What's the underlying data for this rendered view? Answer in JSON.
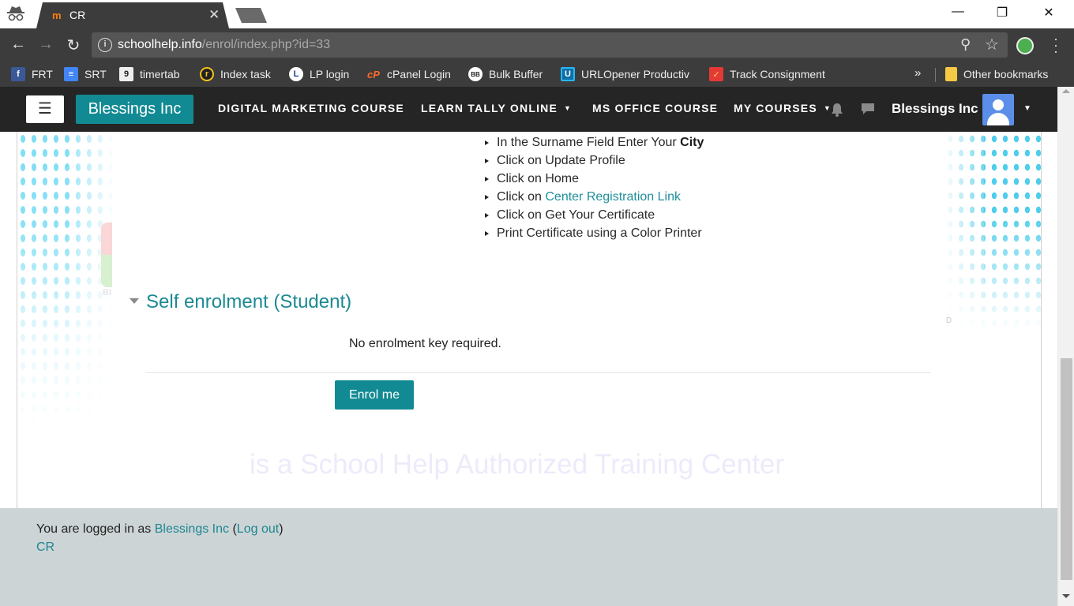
{
  "browser": {
    "tab_title": "CR",
    "tab_close": "✕",
    "window_controls": {
      "minimize": "—",
      "restore": "❐",
      "close": "✕"
    },
    "url_domain": "schoolhelp.info",
    "url_path": "/enrol/index.php?id=33"
  },
  "bookmarks": [
    {
      "label": "FRT",
      "icon": "facebook-icon",
      "color": "#3b5998",
      "glyph": "f"
    },
    {
      "label": "SRT",
      "icon": "docs-icon",
      "color": "#4285f4",
      "glyph": "≡"
    },
    {
      "label": "timertab",
      "icon": "timer-nine-icon",
      "color": "#eeeeee",
      "glyph": "9"
    },
    {
      "label": "Index task",
      "icon": "index-task-icon",
      "color": "#f4c21a",
      "glyph": "r"
    },
    {
      "label": "LP login",
      "icon": "lp-icon",
      "color": "#ffffff",
      "glyph": "L"
    },
    {
      "label": "cPanel Login",
      "icon": "cpanel-icon",
      "color": "#ff6c2c",
      "glyph": "cP"
    },
    {
      "label": "Bulk Buffer",
      "icon": "bulk-buffer-icon",
      "color": "#ffffff",
      "glyph": "BB"
    },
    {
      "label": "URLOpener Productiv",
      "icon": "urlopener-icon",
      "color": "#29b6f6",
      "glyph": "U"
    },
    {
      "label": "Track Consignment",
      "icon": "track-consignment-icon",
      "color": "#e53935",
      "glyph": "✓"
    }
  ],
  "bookmarks_more": "»",
  "other_bookmarks": "Other bookmarks",
  "site": {
    "menu_glyph": "☰",
    "brand": "Blessings Inc",
    "nav": {
      "digital_marketing": "DIGITAL MARKETING COURSE",
      "learn_tally": "LEARN TALLY ONLINE",
      "ms_office": "MS OFFICE COURSE",
      "my_courses": "MY COURSES"
    },
    "username": "Blessings Inc"
  },
  "instructions": {
    "step1_prefix": "In the Surname Field Enter Your ",
    "step1_bold": "City",
    "step2": "Click on Update Profile",
    "step3": "Click on Home",
    "step4_prefix": "Click on ",
    "step4_link": "Center Registration Link",
    "step5": "Click on Get Your Certificate",
    "step6": "Print Certificate using a Color Printer"
  },
  "enrolment": {
    "heading": "Self enrolment (Student)",
    "note": "No enrolment key required.",
    "button": "Enrol me"
  },
  "watermark": "is a School Help Authorized Training Center",
  "ghost": {
    "logo_text": "Bl",
    "right_letter": "D"
  },
  "footer": {
    "logged_in_prefix": "You are logged in as ",
    "user_link": "Blessings Inc",
    "open_paren": " (",
    "logout": "Log out",
    "close_paren": ")",
    "site_link": "CR"
  },
  "colors": {
    "accent": "#128a93",
    "navbar": "#252525",
    "footer": "#cdd4d6",
    "browser_chrome": "#3c3c3c"
  }
}
